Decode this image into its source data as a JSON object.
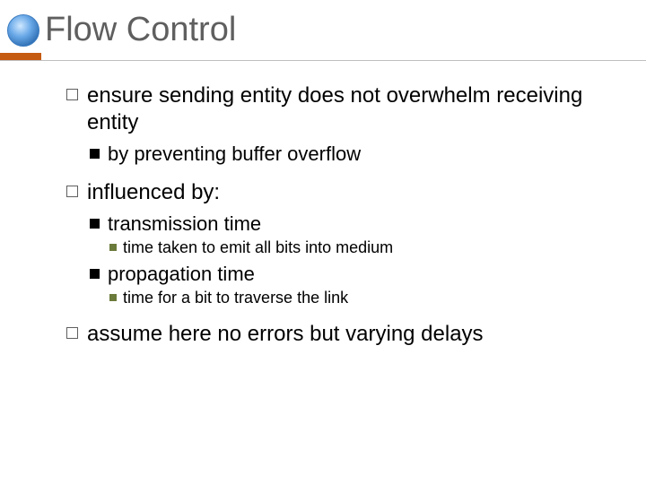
{
  "title": "Flow Control",
  "items": [
    {
      "text": "ensure sending entity does not overwhelm receiving entity",
      "children": [
        {
          "text": "by preventing buffer overflow"
        }
      ]
    },
    {
      "text": "influenced by:",
      "children": [
        {
          "text": "transmission time",
          "children": [
            {
              "text": "time taken to emit all bits into medium"
            }
          ]
        },
        {
          "text": "propagation time",
          "children": [
            {
              "text": "time for a bit to traverse the link"
            }
          ]
        }
      ]
    },
    {
      "text": "assume here no errors but varying delays"
    }
  ]
}
